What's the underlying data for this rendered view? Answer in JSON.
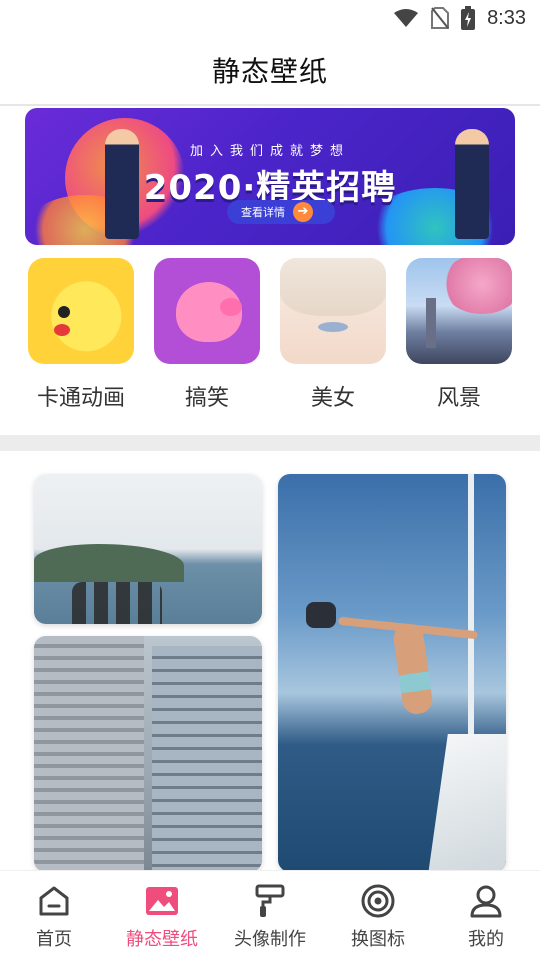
{
  "status_bar": {
    "time": "8:33",
    "icons": [
      "wifi-icon",
      "no-sim-icon",
      "battery-charging-icon"
    ]
  },
  "header": {
    "title": "静态壁纸"
  },
  "banner": {
    "subtitle": "加入我们成就梦想",
    "title": "2020·精英招聘",
    "button_label": "查看详情",
    "button_icon": "arrow-right-icon"
  },
  "categories": [
    {
      "label": "卡通动画",
      "image": "pikachu-thumbnail"
    },
    {
      "label": "搞笑",
      "image": "peppa-pig-thumbnail"
    },
    {
      "label": "美女",
      "image": "anime-girl-thumbnail"
    },
    {
      "label": "风景",
      "image": "cherry-blossom-scenery-thumbnail"
    }
  ],
  "photos": [
    {
      "name": "sea-people-photo"
    },
    {
      "name": "city-buildings-photo"
    },
    {
      "name": "yacht-jump-photo"
    }
  ],
  "tab_bar": {
    "active_tab": "静态壁纸",
    "active_color": "#ef4d7c",
    "tabs": [
      {
        "label": "首页",
        "icon": "home-icon"
      },
      {
        "label": "静态壁纸",
        "icon": "picture-icon"
      },
      {
        "label": "头像制作",
        "icon": "paint-roller-icon"
      },
      {
        "label": "换图标",
        "icon": "target-icon"
      },
      {
        "label": "我的",
        "icon": "user-icon"
      }
    ]
  }
}
